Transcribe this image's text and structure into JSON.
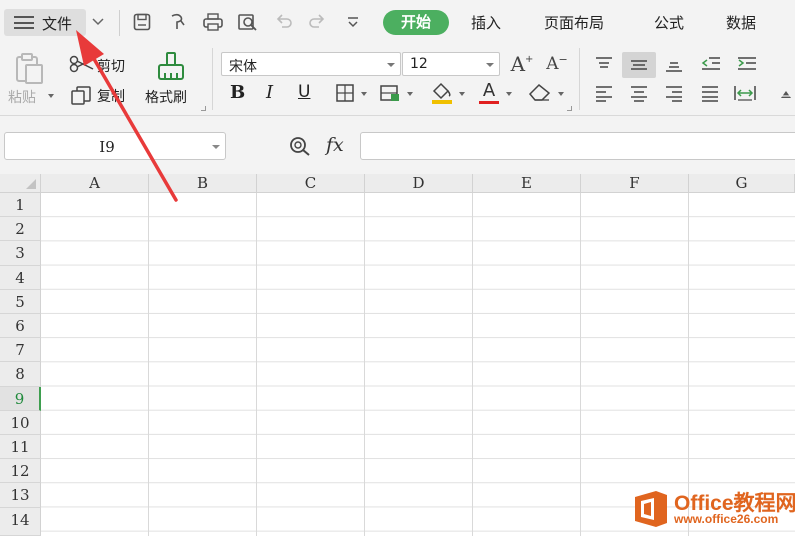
{
  "menubar": {
    "file_label": "文件",
    "tabs": [
      {
        "label": "开始",
        "active": true
      },
      {
        "label": "插入",
        "active": false
      },
      {
        "label": "页面布局",
        "active": false
      },
      {
        "label": "公式",
        "active": false
      },
      {
        "label": "数据",
        "active": false
      }
    ],
    "quick_access_icons": [
      "save-icon",
      "format-painter-quick-icon",
      "print-icon",
      "print-preview-icon",
      "undo-icon",
      "redo-icon",
      "customize-icon"
    ]
  },
  "ribbon": {
    "paste_label": "粘贴",
    "cut_label": "剪切",
    "copy_label": "复制",
    "format_painter_label": "格式刷",
    "font_name": "宋体",
    "font_size": "12",
    "bold": "B",
    "italic": "I",
    "underline": "U",
    "grow_font": "A",
    "shrink_font": "A",
    "font_color_glyph": "A",
    "colors": {
      "font_color": "#e02020",
      "fill_color": "#f0c000",
      "accent": "#4caf60"
    }
  },
  "formula_bar": {
    "name_box": "I9",
    "fx_label": "fx",
    "formula": ""
  },
  "sheet": {
    "columns": [
      "A",
      "B",
      "C",
      "D",
      "E",
      "F",
      "G"
    ],
    "rows": [
      "1",
      "2",
      "3",
      "4",
      "5",
      "6",
      "7",
      "8",
      "9",
      "10",
      "11",
      "12",
      "13",
      "14"
    ],
    "selected_row": "9"
  },
  "watermark": {
    "title": "Office教程网",
    "url": "www.office26.com"
  }
}
